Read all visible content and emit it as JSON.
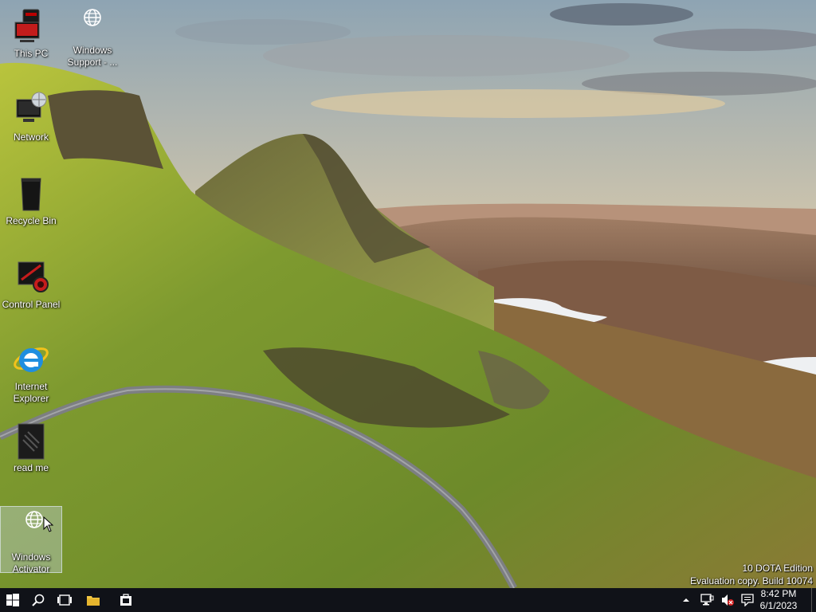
{
  "desktop": {
    "icons": [
      {
        "name": "this-pc",
        "label": "This PC",
        "icon": "computer-icon"
      },
      {
        "name": "windows-support",
        "label": "Windows Support - ...",
        "icon": "globe-icon"
      },
      {
        "name": "network",
        "label": "Network",
        "icon": "network-icon"
      },
      {
        "name": "recycle-bin",
        "label": "Recycle Bin",
        "icon": "recycle-bin-icon"
      },
      {
        "name": "control-panel",
        "label": "Control Panel",
        "icon": "control-panel-icon"
      },
      {
        "name": "internet-explorer",
        "label": "Internet Explorer",
        "icon": "internet-explorer-icon"
      },
      {
        "name": "read-me",
        "label": "read me",
        "icon": "document-icon"
      },
      {
        "name": "windows-activator",
        "label": "Windows Activator",
        "icon": "globe-icon",
        "selected": true
      }
    ]
  },
  "watermark": {
    "line1": "10 DOTA Edition",
    "line2": "Evaluation copy. Build 10074"
  },
  "taskbar": {
    "buttons": [
      "start-icon",
      "search-icon",
      "task-view-icon",
      "file-explorer-icon",
      "store-icon"
    ],
    "tray_icons": [
      "chevron-up-icon",
      "network-tray-icon",
      "volume-muted-icon",
      "action-center-icon"
    ],
    "time": "8:42 PM",
    "date": "6/1/2023"
  }
}
